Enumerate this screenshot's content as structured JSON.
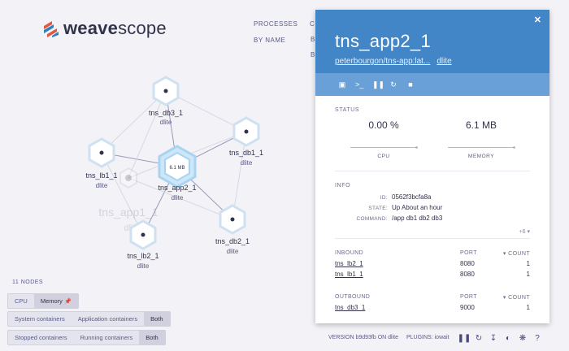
{
  "logo": {
    "weave": "weave",
    "scope": "scope"
  },
  "top_menu": {
    "processes": "PROCESSES",
    "by_name": "BY NAME",
    "stub1": "C",
    "stub2": "B",
    "stub3": "B"
  },
  "graph": {
    "nodes": [
      {
        "name": "tns_db3_1",
        "sub": "dlite"
      },
      {
        "name": "tns_db1_1",
        "sub": "dlite"
      },
      {
        "name": "tns_lb1_1",
        "sub": "dlite"
      },
      {
        "name": "tns_app2_1",
        "sub": "dlite",
        "badge": "6.1 MB"
      },
      {
        "name": "tns_app1_1",
        "sub": "dli"
      },
      {
        "name": "tns_lb2_1",
        "sub": "dlite"
      },
      {
        "name": "tns_db2_1",
        "sub": "dlite"
      }
    ]
  },
  "controls": {
    "node_count": "11 NODES",
    "metric_options": [
      "CPU",
      "Memory"
    ],
    "metric_active": "Memory",
    "containers_options": [
      "System containers",
      "Application containers",
      "Both"
    ],
    "containers_active": "Both",
    "state_options": [
      "Stopped containers",
      "Running containers",
      "Both"
    ],
    "state_active": "Both"
  },
  "footer": {
    "version": "VERSION b9d93fb ON dlite",
    "plugins": "PLUGINS: iowait",
    "icons": [
      "pause-icon",
      "refresh-icon",
      "download-icon",
      "contrast-icon",
      "bug-icon",
      "help-icon"
    ]
  },
  "panel": {
    "title": "tns_app2_1",
    "image": "peterbourgon/tns-app:lat...",
    "host": "dlite",
    "toolbar": [
      "monitor-icon",
      "terminal-icon",
      "pause-icon",
      "restart-icon",
      "stop-icon"
    ],
    "status_title": "STATUS",
    "cpu_value": "0.00 %",
    "cpu_label": "CPU",
    "mem_value": "6.1 MB",
    "mem_label": "MEMORY",
    "info_title": "INFO",
    "info": [
      {
        "key": "ID:",
        "value": "0562f3bcfa8a"
      },
      {
        "key": "STATE:",
        "value": "Up About an hour"
      },
      {
        "key": "COMMAND:",
        "value": "/app db1 db2 db3"
      }
    ],
    "more": "+6",
    "inbound": {
      "title": "INBOUND",
      "port_label": "PORT",
      "count_label": "COUNT",
      "rows": [
        {
          "name": "tns_lb2_1",
          "port": "8080",
          "count": "1"
        },
        {
          "name": "tns_lb1_1",
          "port": "8080",
          "count": "1"
        }
      ]
    },
    "outbound": {
      "title": "OUTBOUND",
      "port_label": "PORT",
      "count_label": "COUNT",
      "rows": [
        {
          "name": "tns_db3_1",
          "port": "9000",
          "count": "1"
        }
      ]
    }
  },
  "colors": {
    "header": "#4286c8",
    "toolbar": "#6aa0d8",
    "selected_node": "#a8d4f2",
    "background": "#f2f2f7"
  }
}
